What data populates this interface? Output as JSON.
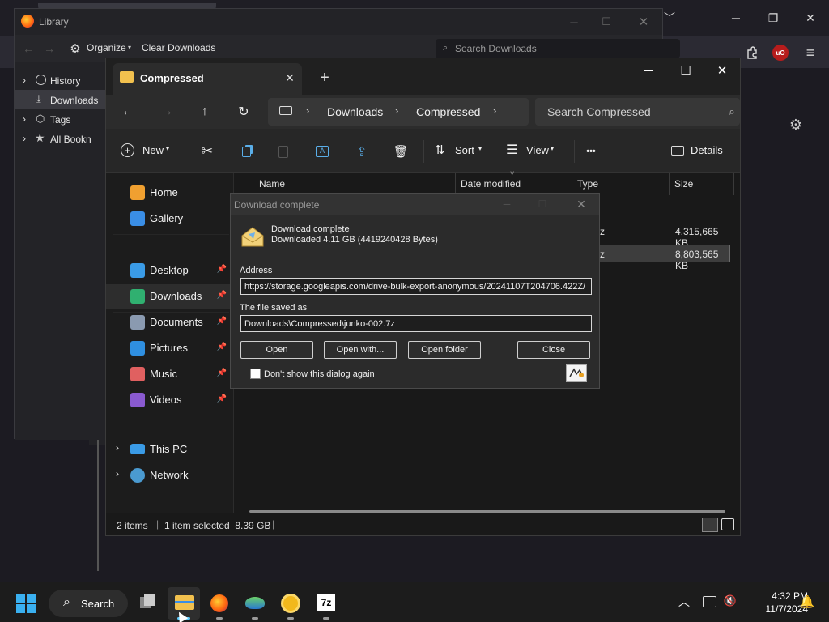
{
  "firefox": {
    "window_controls": {
      "minimize": "─",
      "maximize": "❐",
      "close": "✕"
    },
    "overflow": "﹀"
  },
  "library": {
    "title": "Library",
    "organize": "Organize",
    "clear_downloads": "Clear Downloads",
    "search_placeholder": "Search Downloads",
    "tree": [
      {
        "label": "History",
        "arrow": "›"
      },
      {
        "label": "Downloads",
        "arrow": ""
      },
      {
        "label": "Tags",
        "arrow": "›"
      },
      {
        "label": "All Bookn",
        "arrow": "›"
      }
    ]
  },
  "explorer": {
    "tab_title": "Compressed",
    "new_tab": "+",
    "breadcrumb": [
      "Downloads",
      "Compressed"
    ],
    "search_placeholder": "Search Compressed",
    "commands": {
      "new": "New",
      "sort": "Sort",
      "view": "View",
      "more": "•••",
      "details": "Details"
    },
    "nav": [
      {
        "label": "Home",
        "icon": "home-icon",
        "color": "#f0a030",
        "pinned": false
      },
      {
        "label": "Gallery",
        "icon": "gallery-icon",
        "color": "#3a8ee6",
        "pinned": false
      },
      {
        "label": "Desktop",
        "icon": "desktop-icon",
        "color": "#3a9be6",
        "pinned": true
      },
      {
        "label": "Downloads",
        "icon": "downloads-icon",
        "color": "#30b070",
        "pinned": true
      },
      {
        "label": "Documents",
        "icon": "documents-icon",
        "color": "#8a9ab0",
        "pinned": true
      },
      {
        "label": "Pictures",
        "icon": "pictures-icon",
        "color": "#2f8fe0",
        "pinned": true
      },
      {
        "label": "Music",
        "icon": "music-icon",
        "color": "#e06060",
        "pinned": true
      },
      {
        "label": "Videos",
        "icon": "videos-icon",
        "color": "#8a5ad0",
        "pinned": true
      }
    ],
    "nav_bottom": [
      {
        "label": "This PC",
        "icon": "this-pc-icon"
      },
      {
        "label": "Network",
        "icon": "network-icon"
      }
    ],
    "columns": [
      "Name",
      "Date modified",
      "Type",
      "Size"
    ],
    "files": [
      {
        "type": ".7z",
        "size": "4,315,665 KB"
      },
      {
        "type": ".7z",
        "size": "8,803,565 KB"
      }
    ],
    "status": {
      "items": "2 items",
      "selected": "1 item selected  8.39 GB"
    }
  },
  "dialog": {
    "title": "Download complete",
    "heading": "Download complete",
    "detail": "Downloaded 4.11 GB (4419240428 Bytes)",
    "address_label": "Address",
    "address": "https://storage.googleapis.com/drive-bulk-export-anonymous/20241107T204706.422Z/",
    "saved_label": "The file saved as",
    "saved_path": "Downloads\\Compressed\\junko-002.7z",
    "buttons": {
      "open": "Open",
      "open_with": "Open with...",
      "open_folder": "Open folder",
      "close": "Close"
    },
    "checkbox": "Don't show this dialog again"
  },
  "taskbar": {
    "search": "Search",
    "time": "4:32 PM",
    "date": "11/7/2024",
    "accent": "#60cdff"
  }
}
